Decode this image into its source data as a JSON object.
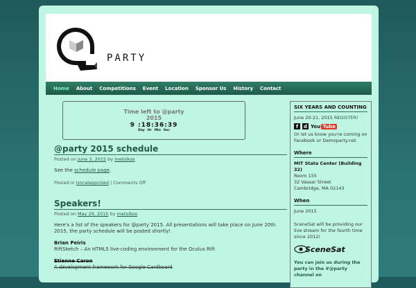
{
  "header": {
    "logo_text": "PARTY"
  },
  "nav": {
    "items": [
      "Home",
      "About",
      "Competitions",
      "Event",
      "Location",
      "Sponsor Us",
      "History",
      "Contact"
    ]
  },
  "countdown": {
    "title_line1": "Time left to @party",
    "title_line2": "2015",
    "time": "9 :18:36:39",
    "units": [
      "Day",
      "Hr",
      "Min",
      "Sec"
    ]
  },
  "posts": [
    {
      "title": "@party 2015 schedule",
      "meta_prefix": "Posted on",
      "date": "June 3, 2015",
      "by": "by",
      "author": "metoikos",
      "body_prefix": "See the",
      "body_link": "schedule page",
      "body_suffix": ".",
      "footer_prefix": "Posted in",
      "category": "Uncategorized",
      "comments": "| Comments Off"
    },
    {
      "title": "Speakers!",
      "meta_prefix": "Posted on",
      "date": "May 29, 2015",
      "by": "by",
      "author": "metoikos",
      "body": "Here's a list of the speakers for @party 2015. All presentations will take place on June 20th 2015, the party schedule will be posted shortly!",
      "speakers": [
        {
          "name": "Brian Peiris",
          "talk": "RiftSketch – An HTML5 live-coding environment for the Oculus Rift",
          "struck": false
        },
        {
          "name": "Etienne Caron",
          "talk": "A development framework for Google Cardboard",
          "struck": true
        }
      ]
    }
  ],
  "sidebar": {
    "heading1": "SIX YEARS AND COUNTING",
    "dates": "June 20-21, 2015",
    "register": "REGISTER!",
    "follow_text": "Or let us know you're coming on Facebook or Demoparty.net.",
    "heading2": "Where",
    "venue": "MIT Stata Center (Building 32)",
    "room": "Room 155",
    "street": "32 Vassar Street",
    "city": "Cambridge, MA 02143",
    "heading3": "When",
    "when": "June 2015",
    "scenesat_text": "SceneSat will be providing our live stream for the fourth time since 2012!",
    "scenesat_logo": "SceneSat",
    "irc_text": "You can join us during the party in the #@party channel on"
  },
  "icons": {
    "facebook": "f",
    "other": "d",
    "you": "You",
    "tube": "Tube"
  }
}
